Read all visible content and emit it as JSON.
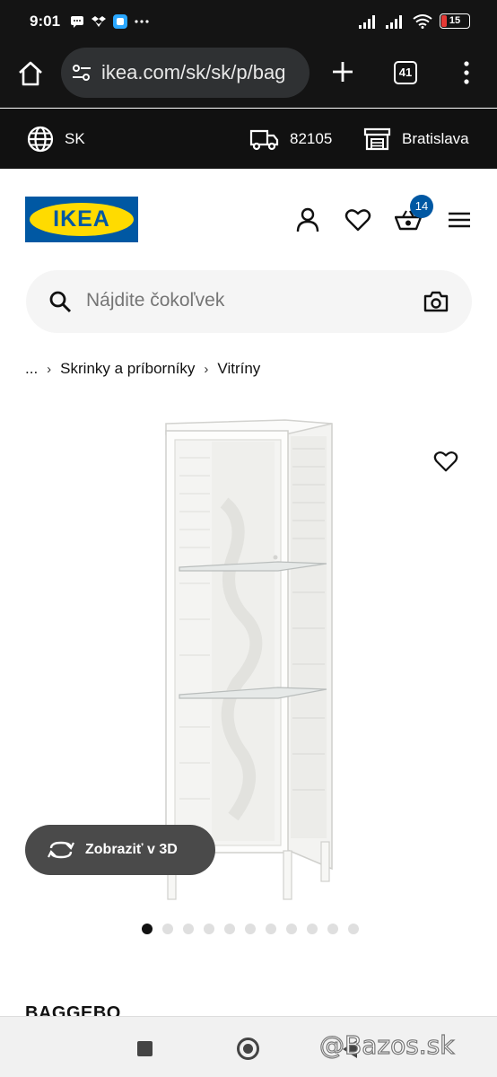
{
  "status_bar": {
    "time": "9:01",
    "battery": "15",
    "icons": [
      "message-icon",
      "dropbox-icon",
      "app-icon",
      "more-dots-icon",
      "signal-icon",
      "signal-icon",
      "wifi-icon",
      "battery-icon"
    ]
  },
  "browser": {
    "url": "ikea.com/sk/sk/p/bag",
    "tab_count": "41"
  },
  "locale_bar": {
    "country": "SK",
    "postal_code": "82105",
    "store": "Bratislava"
  },
  "header": {
    "logo_text": "IKEA",
    "cart_count": "14",
    "colors": {
      "ikea_blue": "#0058a3",
      "ikea_yellow": "#ffdb00"
    }
  },
  "search": {
    "placeholder": "Nájdite čokoľvek"
  },
  "breadcrumb": {
    "ellipsis": "...",
    "items": [
      "Skrinky a príborníky",
      "Vitríny"
    ]
  },
  "product": {
    "view_3d_label": "Zobraziť v 3D",
    "image_count": 11,
    "active_image": 1,
    "name": "BAGGEBO"
  },
  "watermark": "@Bazos.sk"
}
